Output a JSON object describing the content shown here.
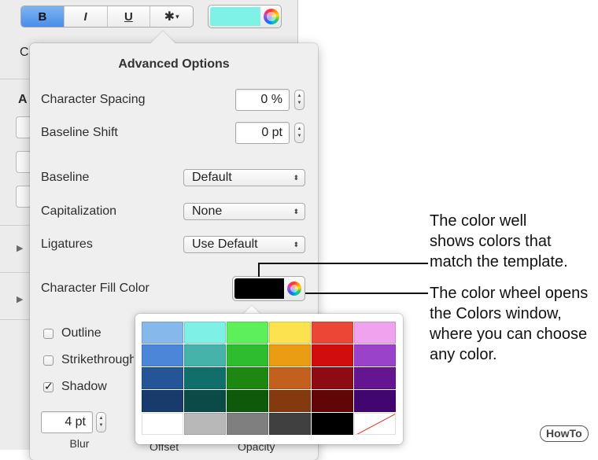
{
  "toolbar": {
    "bold": "B",
    "italic": "I",
    "underline": "U",
    "gear_glyph": "✱",
    "gear_arrow": "▾",
    "top_well_color": "#7ff2e6"
  },
  "background_panel": {
    "letter_c": "C",
    "letter_a": "A",
    "disclosure": "▶"
  },
  "popover": {
    "title": "Advanced Options",
    "character_spacing": {
      "label": "Character Spacing",
      "value": "0 %"
    },
    "baseline_shift": {
      "label": "Baseline Shift",
      "value": "0 pt"
    },
    "baseline": {
      "label": "Baseline",
      "value": "Default"
    },
    "capitalization": {
      "label": "Capitalization",
      "value": "None"
    },
    "ligatures": {
      "label": "Ligatures",
      "value": "Use Default"
    },
    "fill_color": {
      "label": "Character Fill Color",
      "color": "#000000"
    },
    "outline": {
      "label": "Outline",
      "checked": false
    },
    "strikethrough": {
      "label": "Strikethrough",
      "checked": false
    },
    "shadow": {
      "label": "Shadow",
      "checked": true,
      "check": "✓"
    },
    "blur": {
      "label": "Blur",
      "value": "4 pt"
    },
    "offset_label": "Offset",
    "opacity_label": "Opacity",
    "popup_arrow": "⬍"
  },
  "palette": {
    "rows": [
      [
        "#86b8ec",
        "#7ef0e6",
        "#5ef05a",
        "#fde24f",
        "#eb4636",
        "#f0a2ee"
      ],
      [
        "#4b86d9",
        "#46b3aa",
        "#2dbd2f",
        "#ea9c12",
        "#d10d0d",
        "#9a42c9"
      ],
      [
        "#235597",
        "#116f6b",
        "#1d8712",
        "#c4601d",
        "#8e0b13",
        "#64158f"
      ],
      [
        "#193a6c",
        "#0b4b47",
        "#0c5a0a",
        "#84390f",
        "#610507",
        "#43056f"
      ],
      [
        "#ffffff",
        "#b8b8b8",
        "#7f7f7f",
        "#404040",
        "#000000",
        "none"
      ]
    ]
  },
  "callouts": {
    "well": [
      "The color well",
      "shows colors that",
      "match the template."
    ],
    "wheel": [
      "The color wheel opens",
      "the Colors window,",
      "where you can choose",
      "any color."
    ]
  },
  "watermark": "HowTo"
}
